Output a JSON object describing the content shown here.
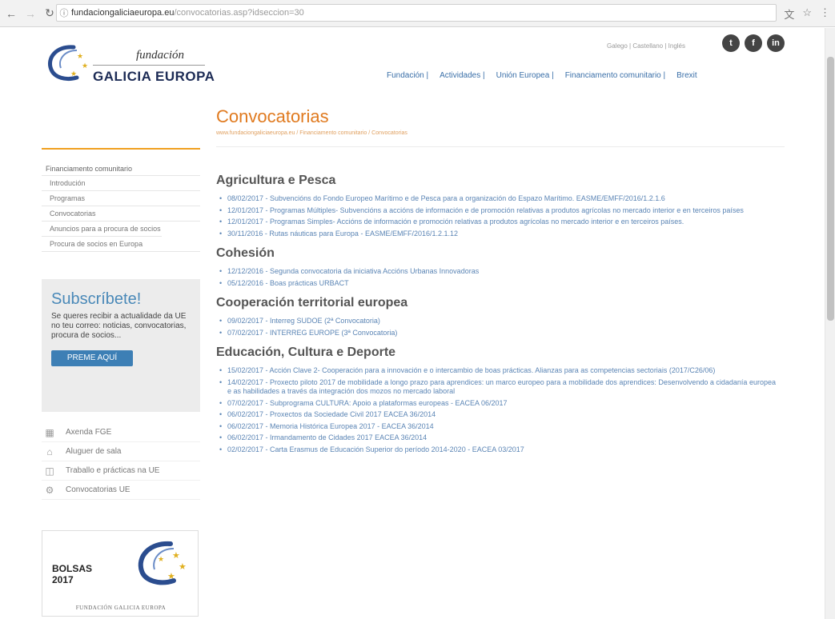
{
  "browser": {
    "url_host": "fundaciongaliciaeuropa.eu",
    "url_path": "/convocatorias.asp?idseccion=30"
  },
  "header": {
    "logo_line1": "fundación",
    "logo_line2": "GALICIA EUROPA",
    "languages": "Galego | Castellano | Inglés",
    "social": [
      "t",
      "f",
      "in"
    ],
    "nav": [
      "Fundación |",
      "Actividades |",
      "Unión Europea |",
      "Financiamento comunitario |",
      "Brexit"
    ]
  },
  "page": {
    "title": "Convocatorias",
    "breadcrumb": "www.fundaciongaliciaeuropa.eu / Financiamento comunitario / Convocatorias"
  },
  "sidebar": {
    "menu_head": "Financiamento comunitario",
    "menu_items": [
      "Introdución",
      "Programas",
      "Convocatorias",
      "Anuncios para a procura de socios",
      "Procura de socios en Europa"
    ],
    "subscribe": {
      "heading": "Subscríbete!",
      "text": "Se queres recibir a actualidade da UE no teu correo: noticias, convocatorias, procura de socios...",
      "button": "PREME AQUÍ"
    },
    "quicklinks": [
      "Axenda FGE",
      "Aluguer de sala",
      "Traballo e prácticas na UE",
      "Convocatorias UE"
    ],
    "banner": {
      "title1": "BOLSAS",
      "title2": "2017",
      "footer": "FUNDACIÓN GALICIA EUROPA"
    }
  },
  "content": {
    "sections": [
      {
        "heading": "Agricultura e Pesca",
        "items": [
          "08/02/2017 - Subvencións do Fondo Europeo Marítimo e de Pesca para a organización do Espazo Marítimo. EASME/EMFF/2016/1.2.1.6",
          "12/01/2017 - Programas Múltiples- Subvencións a accións de información e de promoción relativas a produtos agrícolas no mercado interior e en terceiros países",
          "12/01/2017 - Programas Simples- Accións de información e promoción relativas a produtos agrícolas no mercado interior e en terceiros países.",
          "30/11/2016 - Rutas náuticas para Europa - EASME/EMFF/2016/1.2.1.12"
        ]
      },
      {
        "heading": "Cohesión",
        "items": [
          "12/12/2016 - Segunda convocatoria da iniciativa Accións Urbanas Innovadoras",
          "05/12/2016 - Boas prácticas URBACT"
        ]
      },
      {
        "heading": "Cooperación territorial europea",
        "items": [
          "09/02/2017 - Interreg SUDOE (2ª Convocatoria)",
          "07/02/2017 - INTERREG EUROPE (3ª Convocatoria)"
        ]
      },
      {
        "heading": "Educación, Cultura e Deporte",
        "items": [
          "15/02/2017 - Acción Clave 2- Cooperación para a innovación e o intercambio de boas prácticas. Alianzas para as competencias sectoriais (2017/C26/06)",
          "14/02/2017 - Proxecto piloto 2017 de mobilidade a longo prazo para aprendices: un marco europeo para a mobilidade dos aprendices: Desenvolvendo a cidadanía europea e as habilidades a través da integración dos mozos no mercado laboral",
          "07/02/2017 - Subprograma CULTURA: Apoio a plataformas europeas - EACEA 06/2017",
          "06/02/2017 - Proxectos da Sociedade Civil 2017 EACEA 36/2014",
          "06/02/2017 - Memoria Histórica Europea 2017 - EACEA 36/2014",
          "06/02/2017 - Irmandamento de Cidades 2017 EACEA 36/2014",
          "02/02/2017 - Carta Erasmus de Educación Superior do período 2014-2020 - EACEA 03/2017"
        ]
      }
    ]
  }
}
